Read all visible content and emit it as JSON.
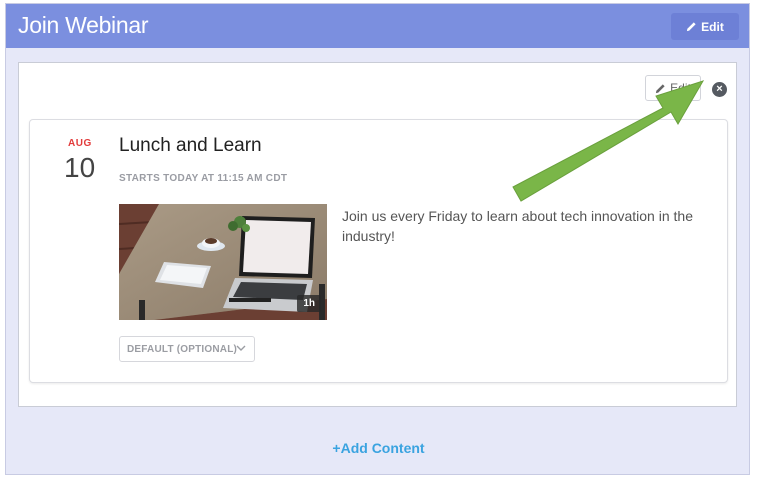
{
  "panel": {
    "title": "Join Webinar",
    "edit_label": "Edit"
  },
  "content": {
    "edit_label": "Edit",
    "close_icon": "close-circle-icon",
    "add_content_label": "+Add Content"
  },
  "event": {
    "month": "AUG",
    "day": "10",
    "title": "Lunch and Learn",
    "starts": "STARTS TODAY AT 11:15 AM CDT",
    "duration": "1h",
    "description": "Join us every Friday to learn about tech innovation in the industry!",
    "select_value": "DEFAULT (OPTIONAL)"
  },
  "colors": {
    "header_bg": "#7b8fdf",
    "panel_bg": "#e6e8f8",
    "month_red": "#e23b3b",
    "link_blue": "#3aa3e0",
    "annotation_arrow": "#7ab648"
  }
}
